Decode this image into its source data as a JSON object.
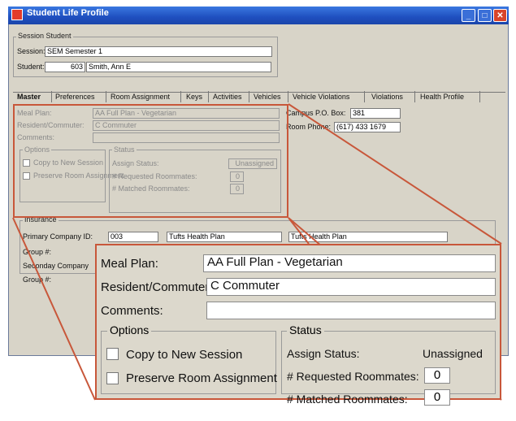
{
  "window": {
    "title": "Student Life Profile"
  },
  "session_group": {
    "title": "Session Student",
    "session_label": "Session:",
    "session_value": "SEM  Semester 1",
    "student_label": "Student:",
    "student_id": "603",
    "student_name": "Smith, Ann E"
  },
  "tabs": [
    "Master",
    "Preferences",
    "Room Assignment",
    "Keys",
    "Activities",
    "Vehicles",
    "Vehicle Violations",
    "Violations",
    "Health Profile"
  ],
  "master": {
    "meal_plan_label": "Meal Plan:",
    "meal_plan_value": "AA   Full Plan - Vegetarian",
    "resident_label": "Resident/Commuter:",
    "resident_value": "C   Commuter",
    "comments_label": "Comments:",
    "comments_value": "",
    "options_title": "Options",
    "copy_label": "Copy to New Session",
    "preserve_label": "Preserve Room Assignment",
    "status_title": "Status",
    "assign_status_label": "Assign Status:",
    "assign_status_value": "Unassigned",
    "requested_label": "# Requested Roommates:",
    "requested_value": "0",
    "matched_label": "# Matched Roommates:",
    "matched_value": "0",
    "campus_po_label": "Campus P.O. Box:",
    "campus_po_value": "381",
    "room_phone_label": "Room Phone:",
    "room_phone_value": "(617) 433 1679"
  },
  "insurance": {
    "title": "Insurance",
    "primary_label": "Primary Company ID:",
    "primary_id": "003",
    "primary_name": "Tufts Health Plan",
    "primary_name2": "Tufts Health Plan",
    "group_label": "Group #:",
    "secondary_label": "Seconday Company",
    "group2_label": "Group #:"
  },
  "zoom": {
    "meal_plan_label": "Meal Plan:",
    "meal_plan_value": "AA   Full Plan - Vegetarian",
    "resident_label": "Resident/Commuter:",
    "resident_value": "C   Commuter",
    "comments_label": "Comments:",
    "options_title": "Options",
    "copy_label": "Copy to New Session",
    "preserve_label": "Preserve Room Assignment",
    "status_title": "Status",
    "assign_status_label": "Assign Status:",
    "assign_status_value": "Unassigned",
    "requested_label": "# Requested Roommates:",
    "requested_value": "0",
    "matched_label": "# Matched Roommates:",
    "matched_value": "0"
  },
  "colors": {
    "title_bar": "#1f4fbf",
    "highlight": "#c8573a",
    "window_bg": "#d8d4c8"
  }
}
